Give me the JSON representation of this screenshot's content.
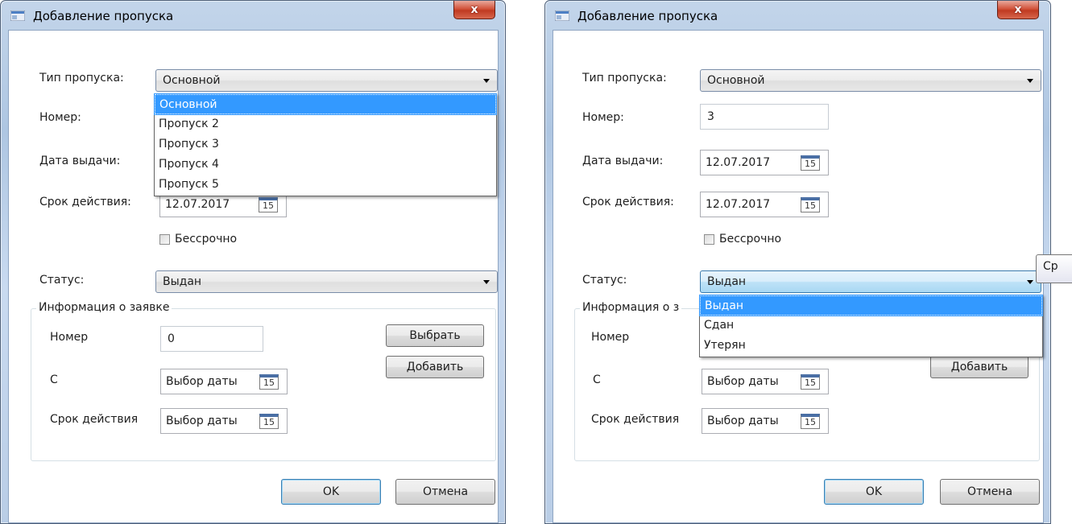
{
  "window": {
    "title": "Добавление пропуска",
    "close_glyph": "x"
  },
  "labels": {
    "pass_type": "Тип пропуска:",
    "number": "Номер:",
    "issue_date": "Дата выдачи:",
    "validity": "Срок действия:",
    "unlimited": "Бессрочно",
    "status": "Статус:"
  },
  "pass_type": {
    "value": "Основной",
    "options": [
      "Основной",
      "Пропуск 2",
      "Пропуск 3",
      "Пропуск 4",
      "Пропуск 5"
    ]
  },
  "number_value": "3",
  "issue_date_value": "12.07.2017",
  "validity_value": "12.07.2017",
  "calendar_icon_text": "15",
  "status": {
    "value": "Выдан",
    "options": [
      "Выдан",
      "Сдан",
      "Утерян"
    ]
  },
  "request": {
    "title": "Информация о заявке",
    "title_clipped": "Информация о з",
    "number_label": "Номер",
    "number_value": "0",
    "from_label": "С",
    "validity_label": "Срок действия",
    "date_placeholder": "Выбор даты",
    "select_button": "Выбрать",
    "add_button": "Добавить"
  },
  "buttons": {
    "ok": "OK",
    "cancel": "Отмена"
  },
  "tooltip": {
    "text": "Ср"
  },
  "icons": {
    "app": "app-window-icon",
    "close": "close-icon",
    "dropdown": "chevron-down-icon",
    "calendar": "calendar-icon"
  }
}
